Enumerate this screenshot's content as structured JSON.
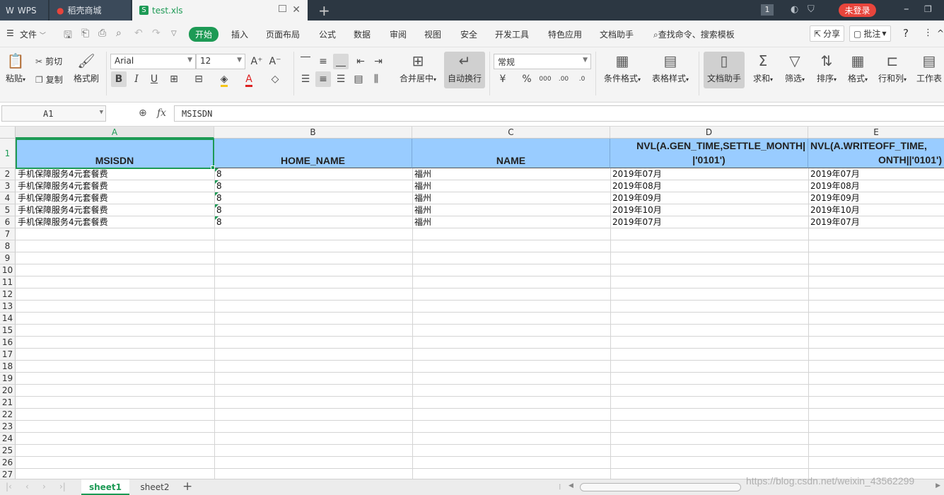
{
  "titlebar": {
    "tabs": [
      {
        "label": "WPS",
        "icon": "wps-logo-icon"
      },
      {
        "label": "稻壳商城",
        "icon": "docer-flame-icon"
      },
      {
        "label": "test.xls",
        "icon": "spreadsheet-s-icon"
      }
    ],
    "login_label": "未登录",
    "page_badge": "1"
  },
  "menubar": {
    "file_label": "文件",
    "items": [
      "开始",
      "插入",
      "页面布局",
      "公式",
      "数据",
      "审阅",
      "视图",
      "安全",
      "开发工具",
      "特色应用",
      "文档助手"
    ],
    "search_label": "查找命令、搜索模板",
    "share_label": "分享",
    "comment_label": "批注"
  },
  "ribbon": {
    "paste": "粘贴",
    "cut": "剪切",
    "copy": "复制",
    "format_painter": "格式刷",
    "font_name": "Arial",
    "font_size": "12",
    "merge_center": "合并居中",
    "wrap_text": "自动换行",
    "number_format": "常规",
    "conditional_format": "条件格式",
    "table_style": "表格样式",
    "doc_assistant": "文档助手",
    "sum": "求和",
    "filter": "筛选",
    "sort": "排序",
    "format": "格式",
    "row_col": "行和列",
    "worksheet": "工作表"
  },
  "formula_bar": {
    "cell_ref": "A1",
    "fx": "fx",
    "value": "MSISDN"
  },
  "sheet": {
    "columns": [
      "A",
      "B",
      "C",
      "D",
      "E"
    ],
    "row_numbers": [
      "1",
      "2",
      "3",
      "4",
      "5",
      "6",
      "7",
      "8",
      "9",
      "10",
      "11",
      "12",
      "13",
      "14",
      "15",
      "16",
      "17",
      "18",
      "19",
      "20",
      "21",
      "22",
      "23",
      "24",
      "25",
      "26",
      "27"
    ],
    "headers": {
      "A": "MSISDN",
      "B": "HOME_NAME",
      "C": "NAME",
      "D1": "NVL(A.GEN_TIME,SETTLE_MONTH|",
      "D2": "|'0101')",
      "E1": "NVL(A.WRITEOFF_TIME,",
      "E2": "ONTH||'0101')"
    },
    "rows": [
      {
        "a": "手机保障服务4元套餐费",
        "b": "8",
        "c": "福州",
        "d": "2019年07月",
        "e": "2019年07月"
      },
      {
        "a": "手机保障服务4元套餐费",
        "b": "8",
        "c": "福州",
        "d": "2019年08月",
        "e": "2019年08月"
      },
      {
        "a": "手机保障服务4元套餐费",
        "b": "8",
        "c": "福州",
        "d": "2019年09月",
        "e": "2019年09月"
      },
      {
        "a": "手机保障服务4元套餐费",
        "b": "8",
        "c": "福州",
        "d": "2019年10月",
        "e": "2019年10月"
      },
      {
        "a": "手机保障服务4元套餐费",
        "b": "8",
        "c": "福州",
        "d": "2019年07月",
        "e": "2019年07月"
      }
    ]
  },
  "sheetbar": {
    "tabs": [
      "sheet1",
      "sheet2"
    ],
    "active": "sheet1"
  },
  "watermark": "https://blog.csdn.net/weixin_43562299",
  "colors": {
    "accent": "#1d9a55",
    "header_fill": "#99ccff",
    "login": "#e8453c"
  }
}
